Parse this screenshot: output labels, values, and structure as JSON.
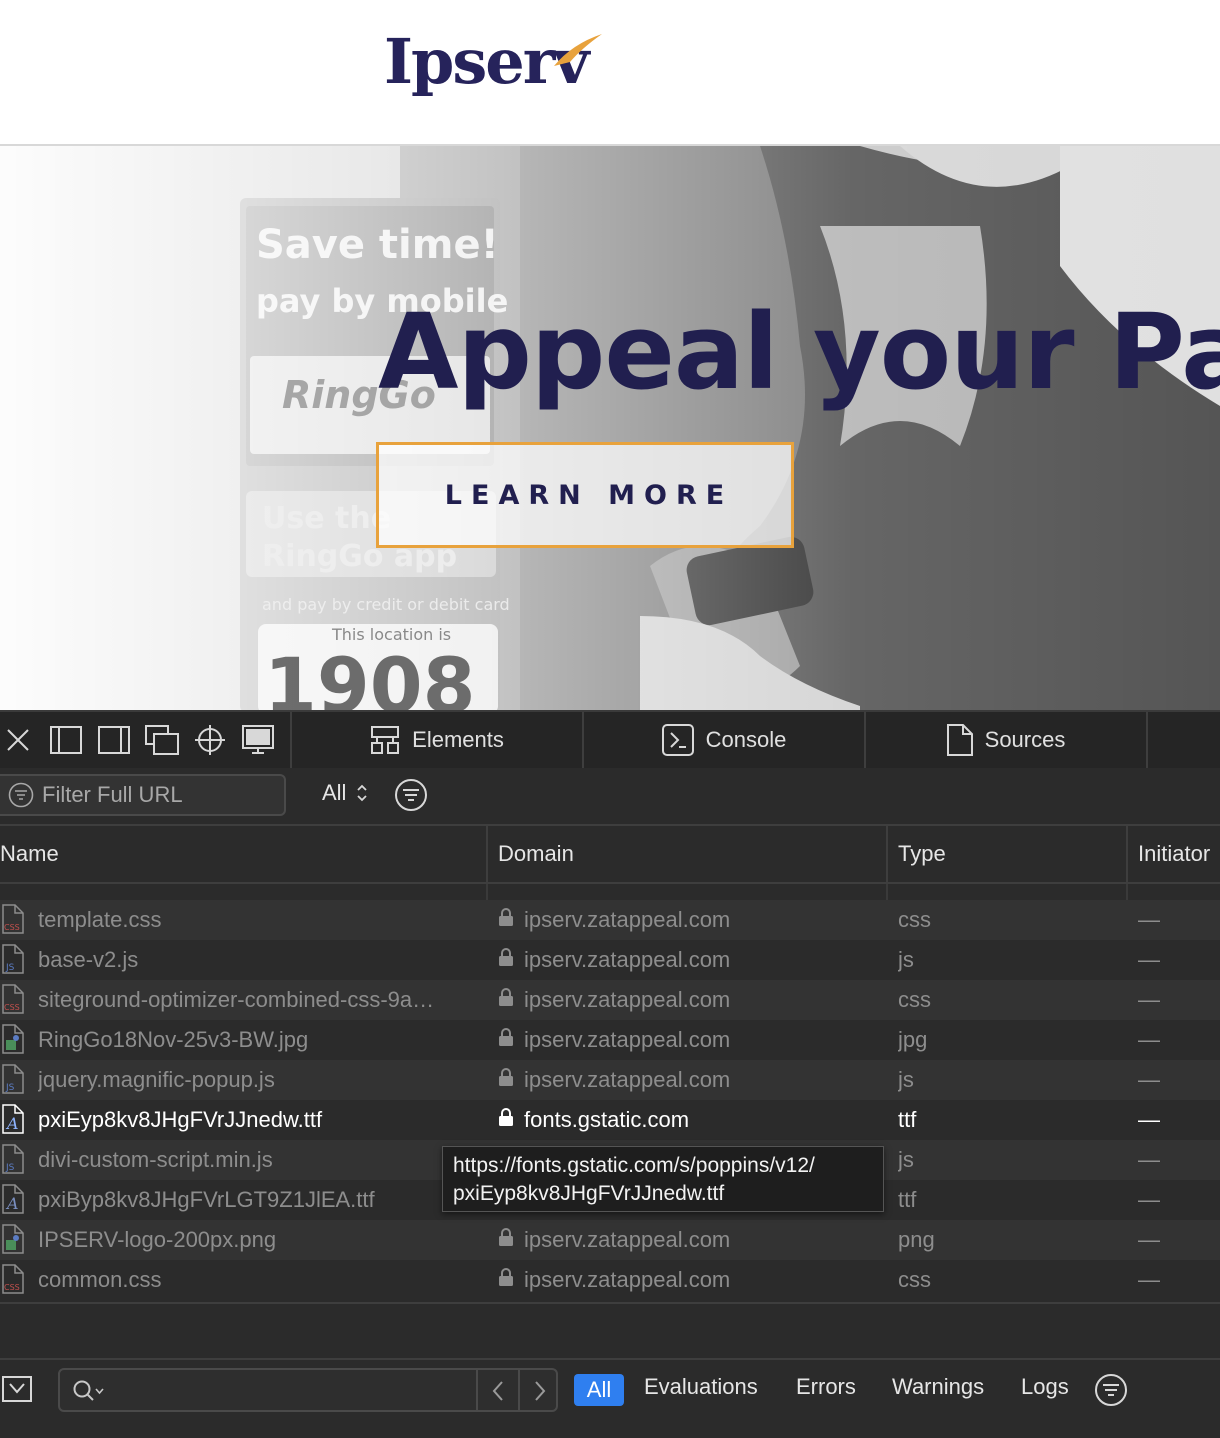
{
  "site": {
    "logo_text": "Ipserv",
    "hero_title": "Appeal your Par",
    "learn_more": "LEARN MORE",
    "sign_save": "Save time!",
    "sign_pay": "pay by mobile",
    "sign_ring": "RingGo",
    "sign_use": "Use the",
    "sign_app": "RingGo app",
    "sign_card": "and pay by credit or debit card",
    "sign_location": "This location is",
    "sign_number": "1908"
  },
  "devtools": {
    "tabs": [
      {
        "label": "Elements",
        "icon": "elements-icon"
      },
      {
        "label": "Console",
        "icon": "console-icon"
      },
      {
        "label": "Sources",
        "icon": "sources-icon"
      }
    ],
    "filter_placeholder": "Filter Full URL",
    "type_filter": "All",
    "columns": [
      "Name",
      "Domain",
      "Type",
      "Initiator"
    ],
    "rows": [
      {
        "name": "template.css",
        "domain": "ipserv.zatappeal.com",
        "type": "css",
        "initiator": "—",
        "icon": "css"
      },
      {
        "name": "base-v2.js",
        "domain": "ipserv.zatappeal.com",
        "type": "js",
        "initiator": "—",
        "icon": "js"
      },
      {
        "name": "siteground-optimizer-combined-css-9a…",
        "domain": "ipserv.zatappeal.com",
        "type": "css",
        "initiator": "—",
        "icon": "css"
      },
      {
        "name": "RingGo18Nov-25v3-BW.jpg",
        "domain": "ipserv.zatappeal.com",
        "type": "jpg",
        "initiator": "—",
        "icon": "img"
      },
      {
        "name": "jquery.magnific-popup.js",
        "domain": "ipserv.zatappeal.com",
        "type": "js",
        "initiator": "—",
        "icon": "js"
      },
      {
        "name": "pxiEyp8kv8JHgFVrJJnedw.ttf",
        "domain": "fonts.gstatic.com",
        "type": "ttf",
        "initiator": "—",
        "icon": "font",
        "selected": true
      },
      {
        "name": "divi-custom-script.min.js",
        "domain": "ipserv.zatappeal.com",
        "type": "js",
        "initiator": "—",
        "icon": "js"
      },
      {
        "name": "pxiByp8kv8JHgFVrLGT9Z1JlEA.ttf",
        "domain": "",
        "type": "ttf",
        "initiator": "—",
        "icon": "font"
      },
      {
        "name": "IPSERV-logo-200px.png",
        "domain": "ipserv.zatappeal.com",
        "type": "png",
        "initiator": "—",
        "icon": "img"
      },
      {
        "name": "common.css",
        "domain": "ipserv.zatappeal.com",
        "type": "css",
        "initiator": "—",
        "icon": "css"
      }
    ],
    "tooltip_line1": "https://fonts.gstatic.com/s/poppins/v12/",
    "tooltip_line2": "pxiEyp8kv8JHgFVrJJnedw.ttf",
    "console_levels": [
      "All",
      "Evaluations",
      "Errors",
      "Warnings",
      "Logs"
    ],
    "accent_color": "#2f7ff0"
  }
}
